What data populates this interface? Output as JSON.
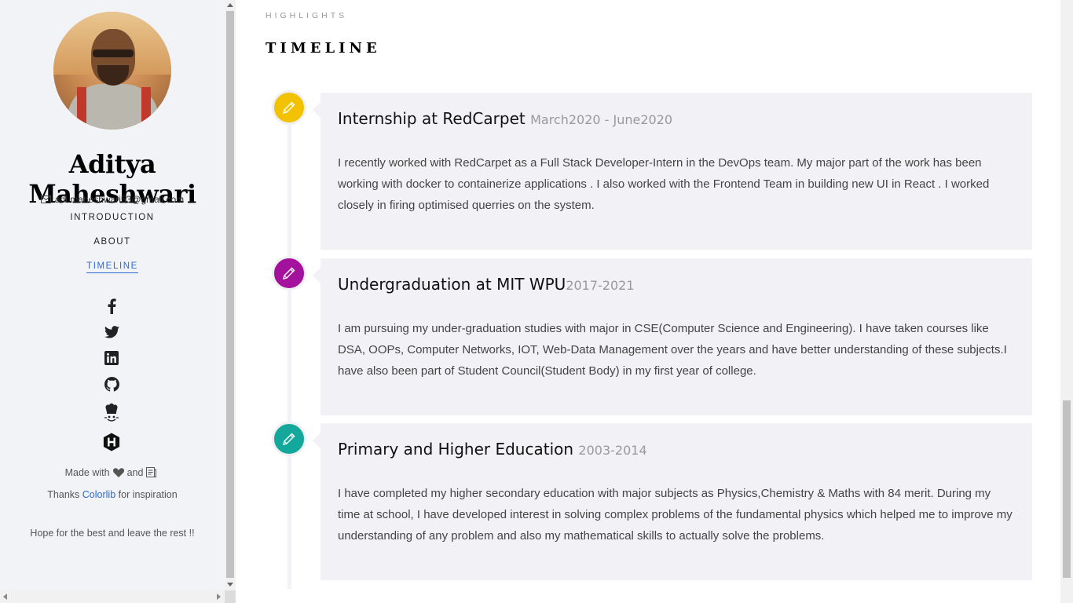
{
  "sidebar": {
    "name": "Aditya Maheshwari",
    "email": "adi.maheshwari53@gmail.com",
    "nav": [
      {
        "label": "INTRODUCTION",
        "active": false
      },
      {
        "label": "ABOUT",
        "active": false
      },
      {
        "label": "TIMELINE",
        "active": true
      }
    ],
    "social_icons": [
      "facebook-icon",
      "twitter-icon",
      "linkedin-icon",
      "github-icon",
      "codechef-icon",
      "hackerrank-icon"
    ],
    "made_with_prefix": "Made with",
    "made_with_and": "and",
    "thanks_prefix": "Thanks",
    "thanks_link": "Colorlib",
    "thanks_suffix": "for inspiration",
    "hope": "Hope for the best and leave the rest !!"
  },
  "main": {
    "kicker": "HIGHLIGHTS",
    "title": "TIMELINE",
    "entries": [
      {
        "title": "Internship at RedCarpet",
        "date": "March2020 - June2020",
        "text": "I recently worked with RedCarpet as a Full Stack Developer-Intern in the DevOps team. My major part of the work has been working with docker to containerize applications . I also worked with the Frontend Team in building new UI in React . I worked closely in firing optimised querries on the system.",
        "color": "#f2c200"
      },
      {
        "title": "Undergraduation at MIT WPU",
        "date": "2017-2021",
        "text": "I am pursuing my under-graduation studies with major in CSE(Computer Science and Engineering). I have taken courses like DSA, OOPs, Computer Networks, IOT, Web-Data Management over the years and have better understanding of these subjects.I have also been part of Student Council(Student Body) in my first year of college.",
        "color": "#a4119c"
      },
      {
        "title": "Primary and Higher Education",
        "date": "2003-2014",
        "text": "I have completed my higher secondary education with major subjects as Physics,Chemistry & Maths with 84 merit. During my time at school, I have developed interest in solving complex problems of the fundamental physics which helped me to improve my understanding of any problem and also my mathematical skills to actually solve the problems.",
        "color": "#13a89b"
      }
    ]
  },
  "colors": {
    "accent": "#2d6ad0",
    "sidebar_bg": "#f2f3f7",
    "card_bg": "#f2f2f6"
  }
}
